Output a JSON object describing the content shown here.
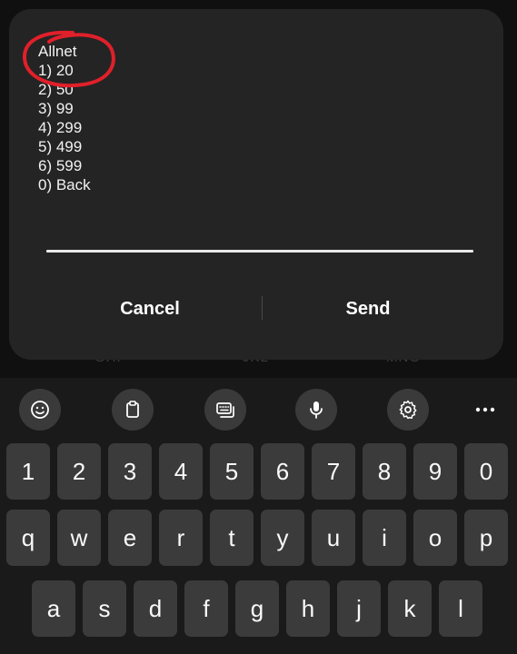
{
  "background": {
    "labels": [
      "GHI",
      "JKL",
      "MNO"
    ]
  },
  "dialog": {
    "lines": [
      "Allnet",
      "1) 20",
      "2) 50",
      "3) 99",
      "4) 299",
      "5) 499",
      "6) 599",
      "0) Back"
    ],
    "input_value": "",
    "cancel_label": "Cancel",
    "send_label": "Send",
    "highlight_color": "#e0202a"
  },
  "keyboard": {
    "toolbar": [
      "emoji-icon",
      "clipboard-icon",
      "keyboard-mode-icon",
      "microphone-icon",
      "settings-icon",
      "more-options-icon"
    ],
    "number_row": [
      "1",
      "2",
      "3",
      "4",
      "5",
      "6",
      "7",
      "8",
      "9",
      "0"
    ],
    "row1": [
      "q",
      "w",
      "e",
      "r",
      "t",
      "y",
      "u",
      "i",
      "o",
      "p"
    ],
    "row2": [
      "a",
      "s",
      "d",
      "f",
      "g",
      "h",
      "j",
      "k",
      "l"
    ]
  },
  "colors": {
    "dialog_bg": "#242424",
    "key_bg": "#3b3b3b",
    "keyboard_bg": "#1a1a1a"
  }
}
